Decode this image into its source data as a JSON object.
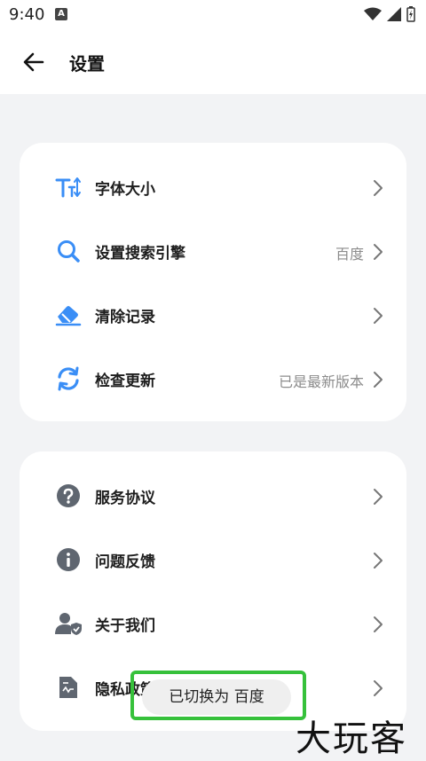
{
  "status": {
    "time": "9:40",
    "app_badge": "A"
  },
  "header": {
    "title": "设置"
  },
  "group1": {
    "items": [
      {
        "label": "字体大小",
        "value": "",
        "icon": "text-size-icon"
      },
      {
        "label": "设置搜索引擎",
        "value": "百度",
        "icon": "search-icon"
      },
      {
        "label": "清除记录",
        "value": "",
        "icon": "eraser-icon"
      },
      {
        "label": "检查更新",
        "value": "已是最新版本",
        "icon": "refresh-icon"
      }
    ]
  },
  "group2": {
    "items": [
      {
        "label": "服务协议",
        "icon": "question-icon"
      },
      {
        "label": "问题反馈",
        "icon": "info-icon"
      },
      {
        "label": "关于我们",
        "icon": "user-shield-icon"
      },
      {
        "label": "隐私政策",
        "icon": "document-icon"
      }
    ]
  },
  "toast": {
    "text": "已切换为 百度"
  },
  "watermark": {
    "text": "大玩客"
  },
  "colors": {
    "accent": "#3a8ef6",
    "gray_icon": "#5f6670",
    "toast_border": "#36c13b"
  }
}
